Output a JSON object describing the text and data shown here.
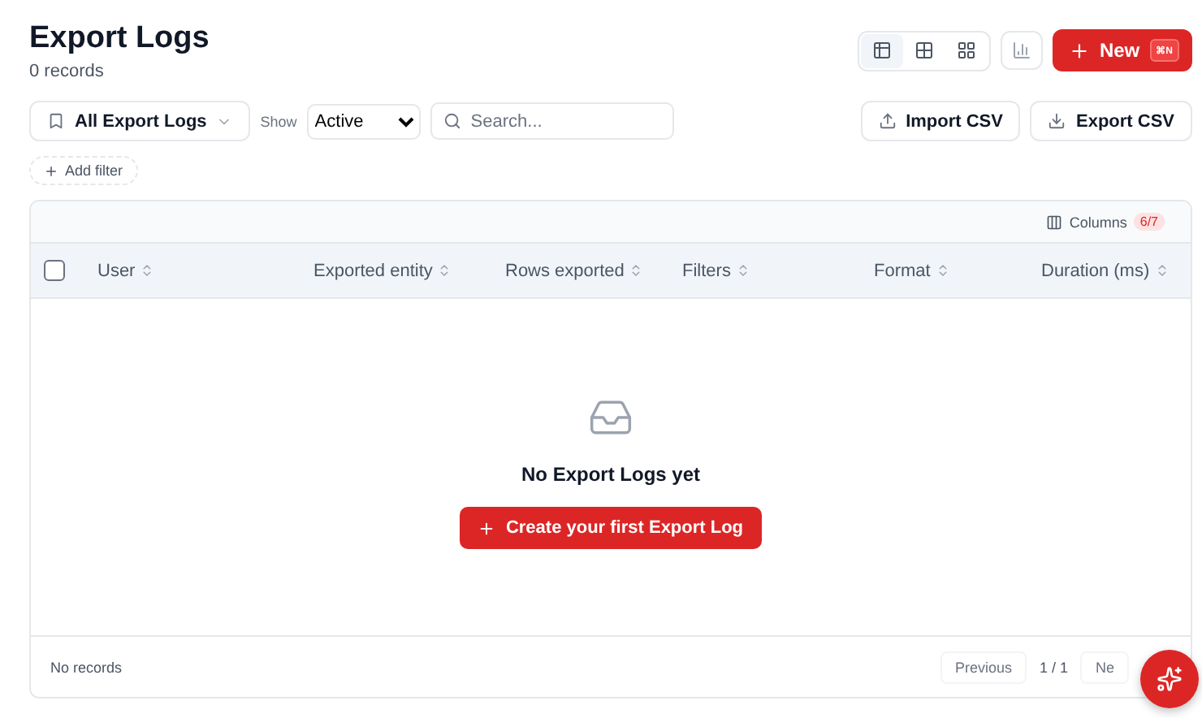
{
  "header": {
    "title": "Export Logs",
    "subtitle": "0 records"
  },
  "view_toggles": [
    {
      "kind": "table",
      "selected": true
    },
    {
      "kind": "grid",
      "selected": false
    },
    {
      "kind": "cards",
      "selected": false
    }
  ],
  "new_button": {
    "label": "New",
    "shortcut": "⌘N"
  },
  "saved_view": {
    "label": "All Export Logs"
  },
  "show": {
    "label": "Show",
    "value": "Active"
  },
  "search": {
    "placeholder": "Search..."
  },
  "actions": [
    "Import CSV",
    "Export CSV"
  ],
  "add_filter": "Add filter",
  "table": {
    "columns_button": {
      "label": "Columns",
      "badge": "6/7"
    },
    "select_all": {
      "checked": false
    },
    "columns": [
      "User",
      "Exported entity",
      "Rows exported",
      "Filters",
      "Format",
      "Duration (ms)"
    ],
    "empty": {
      "title": "No Export Logs yet",
      "button": "Create your first Export Log"
    },
    "footer": {
      "status": "No records",
      "previous": "Previous",
      "page": "1 / 1",
      "next": "Ne"
    }
  }
}
